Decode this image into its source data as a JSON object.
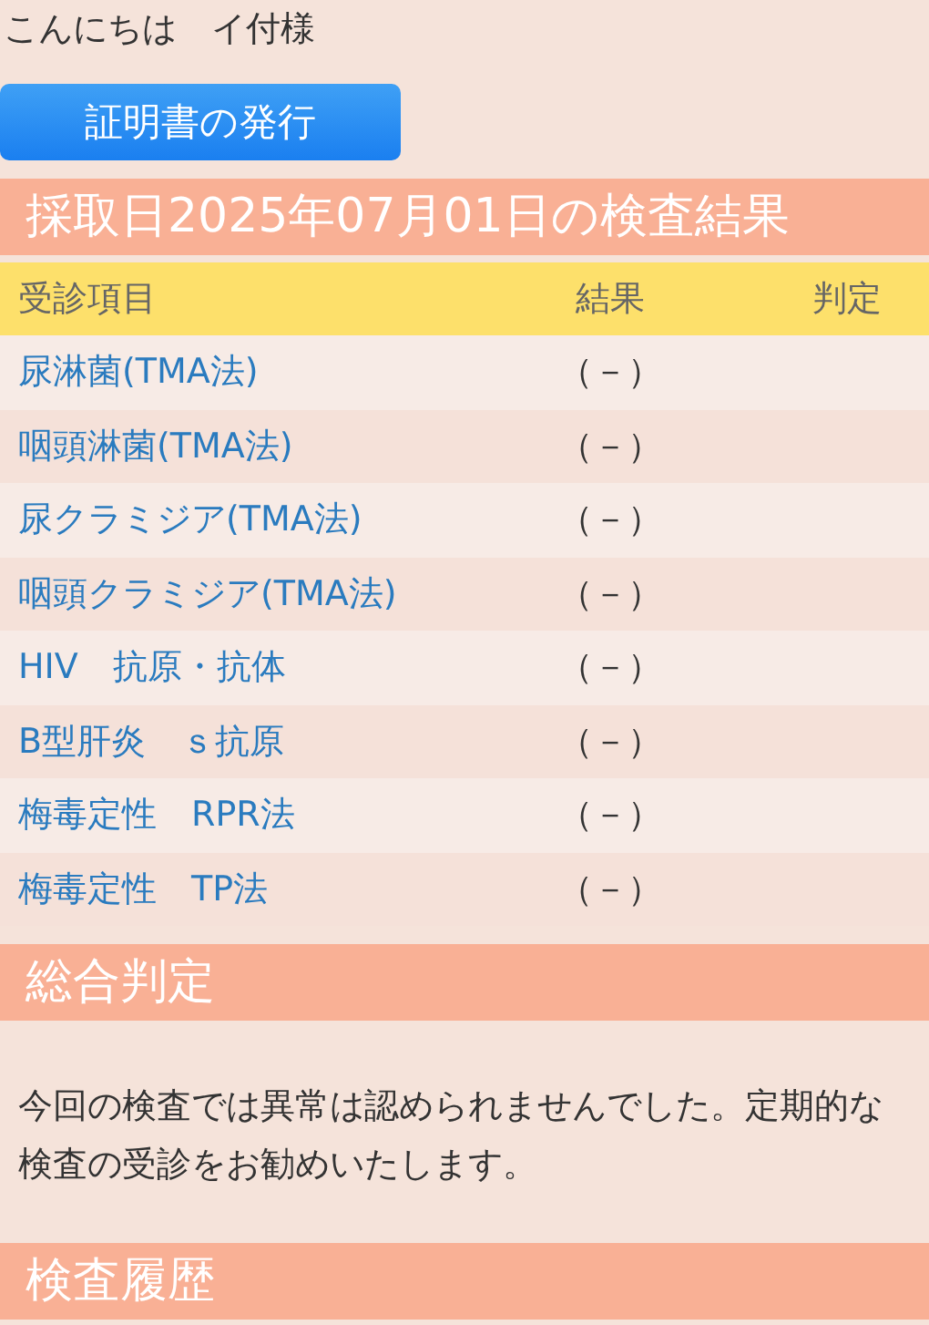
{
  "greeting": "こんにちは　イ付様",
  "certificate_button": "証明書の発行",
  "results_title": "採取日2025年07月01日の検査結果",
  "table": {
    "columns": [
      "受診項目",
      "結果",
      "判定"
    ],
    "rows": [
      {
        "item": "尿淋菌(TMA法)",
        "result": "（－）"
      },
      {
        "item": "咽頭淋菌(TMA法)",
        "result": "（－）"
      },
      {
        "item": "尿クラミジア(TMA法)",
        "result": "（－）"
      },
      {
        "item": "咽頭クラミジア(TMA法)",
        "result": "（－）"
      },
      {
        "item": "HIV　抗原・抗体",
        "result": "（－）"
      },
      {
        "item": "B型肝炎　ｓ抗原",
        "result": "（－）"
      },
      {
        "item": "梅毒定性　RPR法",
        "result": "（－）"
      },
      {
        "item": "梅毒定性　TP法",
        "result": "（－）"
      }
    ]
  },
  "overall_title": "総合判定",
  "overall_text": "今回の検査では異常は認められませんでした。定期的な検査の受診をお勧めいたします。",
  "history_title": "検査履歴"
}
